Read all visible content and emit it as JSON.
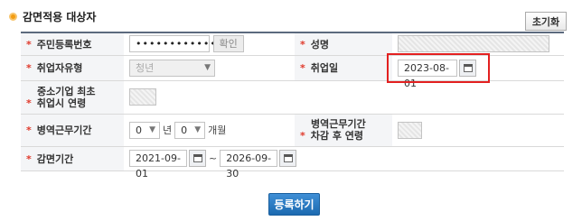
{
  "section": {
    "title": "감면적용 대상자",
    "reset_label": "초기화"
  },
  "fields": {
    "rrn": {
      "label": "주민등록번호",
      "value": "••••••••••••••",
      "check_label": "확인"
    },
    "name": {
      "label": "성명",
      "value": ""
    },
    "emp_type": {
      "label": "취업자유형",
      "value": "청년"
    },
    "emp_date": {
      "label": "취업일",
      "value": "2023-08-01"
    },
    "sme_age": {
      "label_line1": "중소기업 최초",
      "label_line2": "취업시 연령",
      "value": ""
    },
    "military": {
      "label": "병역근무기간",
      "years": "0",
      "year_unit": "년",
      "months": "0",
      "month_unit": "개월"
    },
    "military_age": {
      "label_line1": "병역근무기간",
      "label_line2": "차감 후 연령",
      "value": ""
    },
    "reduction": {
      "label": "감면기간",
      "start": "2021-09-01",
      "sep": "~",
      "end": "2026-09-30"
    }
  },
  "submit_label": "등록하기",
  "colors": {
    "accent": "#1c6ab0",
    "required": "#e0392b",
    "highlight": "#e32020"
  },
  "icons": {
    "calendar": "calendar-icon",
    "dropdown": "chevron-down-icon"
  }
}
